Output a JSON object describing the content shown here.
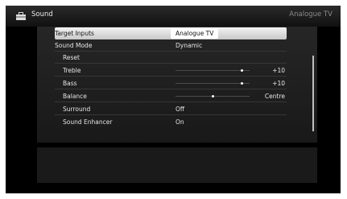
{
  "header": {
    "title": "Sound",
    "icon": "toolbox-icon",
    "source": "Analogue TV"
  },
  "menu": {
    "rows": [
      {
        "label": "Target Inputs",
        "value": "Analogue TV",
        "selected": true
      },
      {
        "label": "Sound Mode",
        "value": "Dynamic"
      },
      {
        "label": "Reset",
        "value": ""
      },
      {
        "label": "Treble",
        "slider_value": "+10",
        "level": 0.9
      },
      {
        "label": "Bass",
        "slider_value": "+10",
        "level": 0.9
      },
      {
        "label": "Balance",
        "slider_value": "Centre",
        "level": 0.5
      },
      {
        "label": "Surround",
        "value": "Off"
      },
      {
        "label": "Sound Enhancer",
        "value": "On"
      }
    ]
  }
}
